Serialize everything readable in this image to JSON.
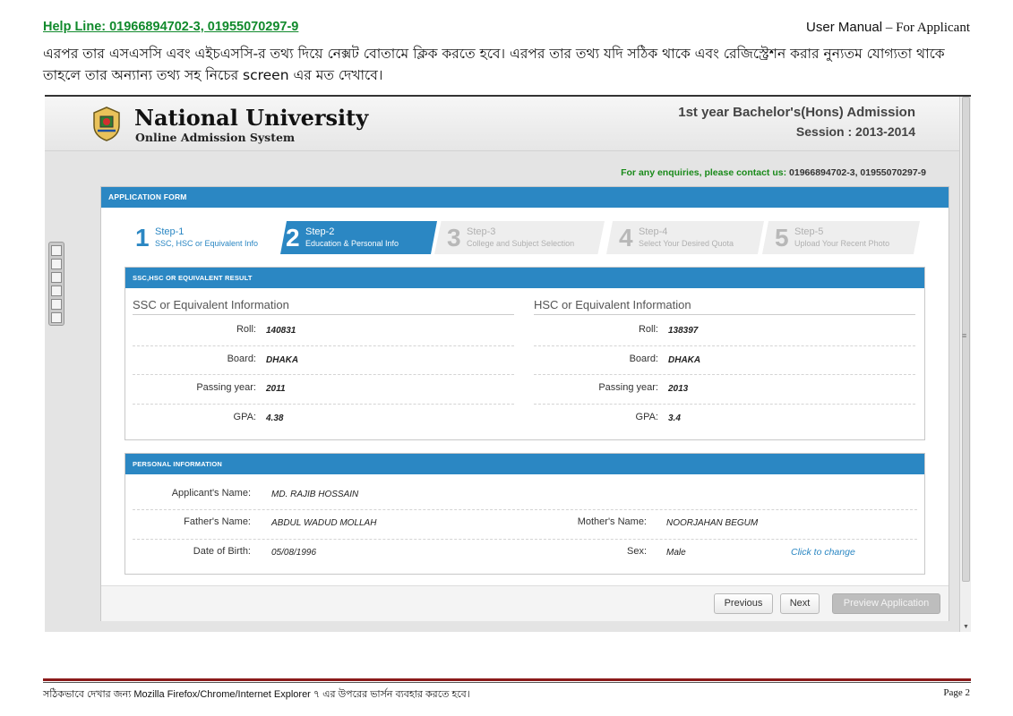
{
  "doc": {
    "helpline": "Help Line: 01966894702-3, 01955070297-9",
    "manual_prefix": "User ",
    "manual_word": "Manual",
    "manual_suffix": " – For Applicant",
    "intro": "এরপর তার এসএসসি এবং এইচএসসি-র তথ্য দিয়ে নেক্সট বোতামে ক্লিক করতে হবে। এরপর তার তথ্য যদি সঠিক থাকে এবং রেজিস্ট্রেশন করার নুন্যতম যোগ্যতা থাকে তাহলে তার অন্যান্য তথ্য সহ নিচের screen এর মত দেখাবে।",
    "footer_note": "সঠিকভাবে দেখার জন্য  Mozilla Firefox/Chrome/Internet Explorer ৭ এর উপরের ভার্সন ব্যবহার করতে হবে।",
    "page": "Page 2"
  },
  "site": {
    "name": "National University",
    "subtitle": "Online Admission System",
    "admission_title": "1st year Bachelor's(Hons) Admission",
    "session": "Session : 2013-2014",
    "enquiry_label": "For any enquiries, please contact us:",
    "enquiry_numbers": "01966894702-3, 01955070297-9"
  },
  "form": {
    "title": "APPLICATION FORM",
    "steps": [
      {
        "num": "1",
        "title": "Step-1",
        "desc": "SSC, HSC or Equivalent Info",
        "state": "done"
      },
      {
        "num": "2",
        "title": "Step-2",
        "desc": "Education & Personal Info",
        "state": "active"
      },
      {
        "num": "3",
        "title": "Step-3",
        "desc": "College and Subject Selection",
        "state": "future"
      },
      {
        "num": "4",
        "title": "Step-4",
        "desc": "Select Your Desired Quota",
        "state": "future"
      },
      {
        "num": "5",
        "title": "Step-5",
        "desc": "Upload Your Recent Photo",
        "state": "future"
      }
    ],
    "result_panel": {
      "title": "SSC,HSC OR EQUIVALENT RESULT",
      "ssc_title": "SSC or Equivalent Information",
      "hsc_title": "HSC or Equivalent Information",
      "labels": {
        "roll": "Roll:",
        "board": "Board:",
        "year": "Passing year:",
        "gpa": "GPA:"
      },
      "ssc": {
        "roll": "140831",
        "board": "DHAKA",
        "year": "2011",
        "gpa": "4.38"
      },
      "hsc": {
        "roll": "138397",
        "board": "DHAKA",
        "year": "2013",
        "gpa": "3.4"
      }
    },
    "personal_panel": {
      "title": "PERSONAL INFORMATION",
      "applicant_label": "Applicant's Name:",
      "applicant": "MD. RAJIB HOSSAIN",
      "father_label": "Father's Name:",
      "father": "ABDUL WADUD MOLLAH",
      "mother_label": "Mother's Name:",
      "mother": "NOORJAHAN BEGUM",
      "dob_label": "Date of Birth:",
      "dob": "05/08/1996",
      "sex_label": "Sex:",
      "sex": "Male",
      "change_link": "Click to change"
    },
    "buttons": {
      "previous": "Previous",
      "next": "Next",
      "preview": "Preview Application"
    }
  }
}
